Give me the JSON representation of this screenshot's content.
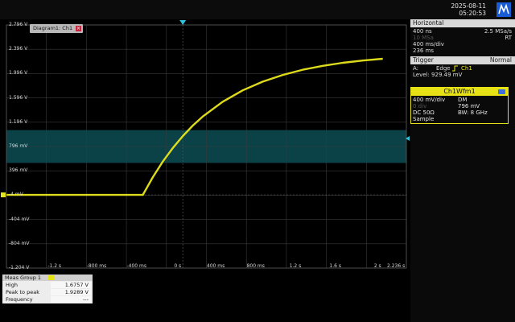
{
  "clock": {
    "date": "2025-08-11",
    "time": "05:20:53"
  },
  "diagram": {
    "tab_label": "Diagram1: Ch1"
  },
  "y_axis": {
    "ticks": [
      {
        "label": "2.796 V",
        "value": 2.796
      },
      {
        "label": "2.396 V",
        "value": 2.396
      },
      {
        "label": "1.996 V",
        "value": 1.996
      },
      {
        "label": "1.596 V",
        "value": 1.596
      },
      {
        "label": "1.196 V",
        "value": 1.196
      },
      {
        "label": "796 mV",
        "value": 0.796
      },
      {
        "label": "396 mV",
        "value": 0.396
      },
      {
        "label": "-4 mV",
        "value": -0.004
      },
      {
        "label": "-404 mV",
        "value": -0.404
      },
      {
        "label": "-804 mV",
        "value": -0.804
      },
      {
        "label": "-1.204 V",
        "value": -1.204
      }
    ],
    "range": [
      -1.204,
      2.796
    ]
  },
  "x_axis": {
    "ticks": [
      {
        "label": "-1.2 s",
        "value": -1.2
      },
      {
        "label": "-800 ms",
        "value": -0.8
      },
      {
        "label": "-400 ms",
        "value": -0.4
      },
      {
        "label": "0 s",
        "value": 0
      },
      {
        "label": "400 ms",
        "value": 0.4
      },
      {
        "label": "800 ms",
        "value": 0.8
      },
      {
        "label": "1.2 s",
        "value": 1.2
      },
      {
        "label": "1.6 s",
        "value": 1.6
      },
      {
        "label": "2 s",
        "value": 2.0
      },
      {
        "label": "2.236 s",
        "value": 2.236
      }
    ],
    "range": [
      -1.764,
      2.236
    ]
  },
  "horizontal": {
    "title": "Horizontal",
    "rows": [
      {
        "left": "400 ns",
        "right": "2.5 MSa/s",
        "dim": false
      },
      {
        "left": "10 MSa",
        "right": "RT",
        "dim": true
      },
      {
        "left": "400 ms/div",
        "right": "",
        "dim": false
      },
      {
        "left": "236 ms",
        "right": "",
        "dim": false
      }
    ]
  },
  "trigger": {
    "title": "Trigger",
    "mode": "Normal",
    "source_prefix": "A:",
    "type": "Edge",
    "channel": "Ch1",
    "level": "Level: 929.49 mV"
  },
  "channel": {
    "title": "Ch1Wfm1",
    "rows": [
      {
        "left": "400 mV/div",
        "right": "DM"
      },
      {
        "left": "0 div",
        "right": "796 mV"
      },
      {
        "left": "DC 50Ω",
        "right": "BW: 8 GHz"
      },
      {
        "left": "Sample",
        "right": ""
      }
    ]
  },
  "measurements": {
    "title": "Meas Group 1",
    "rows": [
      {
        "label": "High",
        "value": "1.6757 V"
      },
      {
        "label": "Peak to peak",
        "value": "1.9289 V"
      },
      {
        "label": "Frequency",
        "value": "---"
      }
    ]
  },
  "chart_data": {
    "type": "line",
    "series": [
      {
        "x": [
          -1.764,
          -0.4,
          -0.3,
          -0.2,
          -0.1,
          0,
          0.1,
          0.2,
          0.4,
          0.6,
          0.8,
          1.0,
          1.2,
          1.4,
          1.6,
          1.8,
          2.0
        ],
        "y": [
          0,
          0,
          0.292,
          0.548,
          0.772,
          0.968,
          1.14,
          1.29,
          1.534,
          1.721,
          1.864,
          1.974,
          2.059,
          2.123,
          2.173,
          2.211,
          2.24
        ]
      }
    ],
    "ylim": [
      -1.204,
      2.796
    ],
    "xlim": [
      -1.764,
      2.236
    ],
    "reference_band": [
      0.526,
      1.066
    ],
    "trigger_level": 0.929,
    "colors": {
      "trace": "#e8e61c",
      "band": "#0d4d55",
      "grid": "#3a3a3a"
    }
  }
}
